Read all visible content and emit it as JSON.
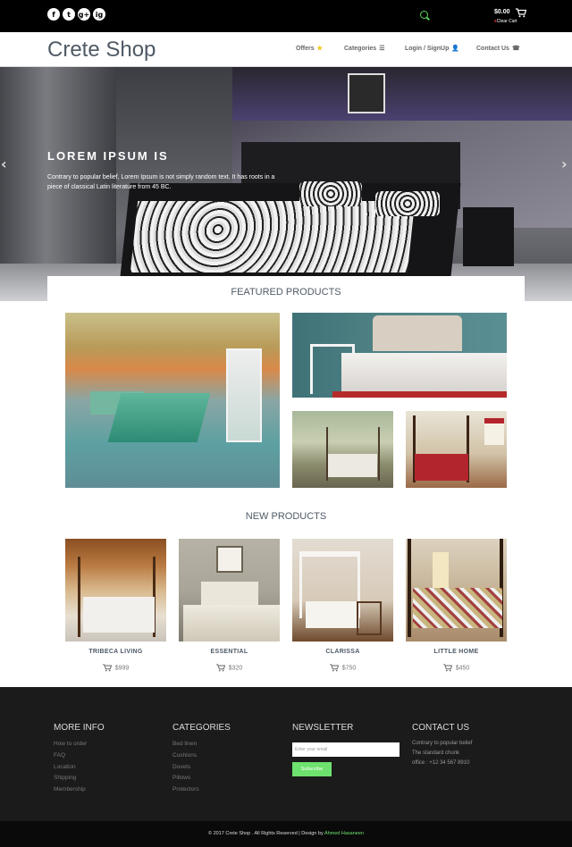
{
  "topbar": {
    "social": [
      "f",
      "t",
      "g+",
      "ig"
    ],
    "cart_amount": "$0.00",
    "cart_clear_x": "x",
    "cart_clear": "Clear Cart"
  },
  "nav": {
    "brand": "Crete Shop",
    "items": [
      {
        "label": "Offers",
        "icon": "star-icon",
        "glyph": "★",
        "color": "#f2c200"
      },
      {
        "label": "Categories",
        "icon": "list-icon",
        "glyph": "☰"
      },
      {
        "label": "Login / SignUp",
        "icon": "user-icon",
        "glyph": "👤"
      },
      {
        "label": "Contact Us",
        "icon": "phone-icon",
        "glyph": "☎"
      }
    ]
  },
  "hero": {
    "title": "LOREM IPSUM IS",
    "text": "Contrary to popular belief, Lorem Ipsum is not simply random text. It has roots in a piece of classical Latin literature from 45 BC.",
    "prev": "‹",
    "next": "›"
  },
  "featured": {
    "title": "FEATURED PRODUCTS"
  },
  "new_products": {
    "title": "NEW PRODUCTS",
    "items": [
      {
        "name": "TRIBECA LIVING",
        "price": "$999"
      },
      {
        "name": "ESSENTIAL",
        "price": "$320"
      },
      {
        "name": "CLARISSA",
        "price": "$750"
      },
      {
        "name": "LITTLE HOME",
        "price": "$450"
      }
    ]
  },
  "footer": {
    "more_info": {
      "title": "MORE INFO",
      "items": [
        "How to order",
        "FAQ",
        "Location",
        "Shipping",
        "Membership"
      ]
    },
    "categories": {
      "title": "CATEGORIES",
      "items": [
        "Bed linen",
        "Cushions",
        "Duvets",
        "Pillows",
        "Protectors"
      ]
    },
    "newsletter": {
      "title": "NEWSLETTER",
      "placeholder": "Enter your email",
      "button": "Subscribe"
    },
    "contact": {
      "title": "CONTACT US",
      "lines": [
        "Contrary to popular belief",
        "The standard chunk",
        "office : +12 34 567 8910"
      ]
    },
    "copyright": "© 2017 Crete Shop . All Rights Reserved | Design by",
    "author": "Ahmed Hasaneen"
  },
  "colors": {
    "accent": "#6ee26e",
    "heading": "#4f5a66",
    "footer_bg": "#1b1b1b"
  }
}
